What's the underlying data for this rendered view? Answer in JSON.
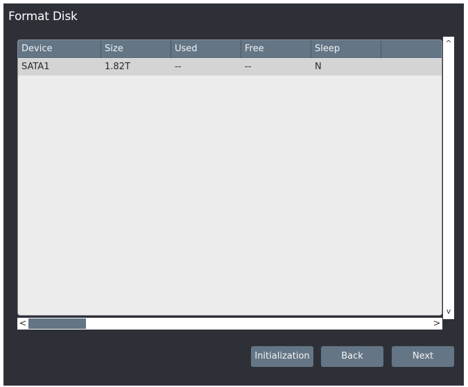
{
  "dialog": {
    "title": "Format Disk"
  },
  "table": {
    "columns": [
      "Device",
      "Size",
      "Used",
      "Free",
      "Sleep",
      ""
    ],
    "rows": [
      [
        "SATA1",
        "1.82T",
        "--",
        "--",
        "N"
      ]
    ]
  },
  "scrollbars": {
    "vertical_up_glyph": "^",
    "vertical_down_glyph": "v",
    "horizontal_left_glyph": "<",
    "horizontal_right_glyph": ">"
  },
  "buttons": {
    "initialization": "Initialization",
    "back": "Back",
    "next": "Next"
  },
  "colors": {
    "dialog_bg": "#2e3038",
    "accent": "#647585",
    "table_bg": "#ececec",
    "row_bg": "#d4d4d4"
  }
}
